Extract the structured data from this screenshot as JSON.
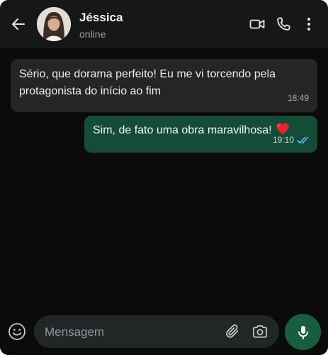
{
  "header": {
    "contact_name": "Jéssica",
    "status": "online",
    "icons": [
      "back-arrow-icon",
      "video-call-icon",
      "voice-call-icon",
      "more-options-icon"
    ]
  },
  "messages": [
    {
      "direction": "incoming",
      "text": "Sério, que dorama perfeito! Eu me vi torcendo pela protagonista do início ao fim",
      "time": "18:49"
    },
    {
      "direction": "outgoing",
      "text": "Sim, de fato uma obra maravilhosa!",
      "emoji": "red-heart",
      "time": "19:10",
      "status": "read"
    }
  ],
  "composer": {
    "placeholder": "Mensagem",
    "value": "",
    "icons": [
      "emoji-icon",
      "attach-icon",
      "camera-icon",
      "microphone-icon"
    ]
  },
  "colors": {
    "background": "#0b0b0b",
    "header": "#161717",
    "incoming_bubble": "#242626",
    "outgoing_bubble": "#134d37",
    "read_ticks": "#53bdeb",
    "mic_button": "#165e41"
  }
}
